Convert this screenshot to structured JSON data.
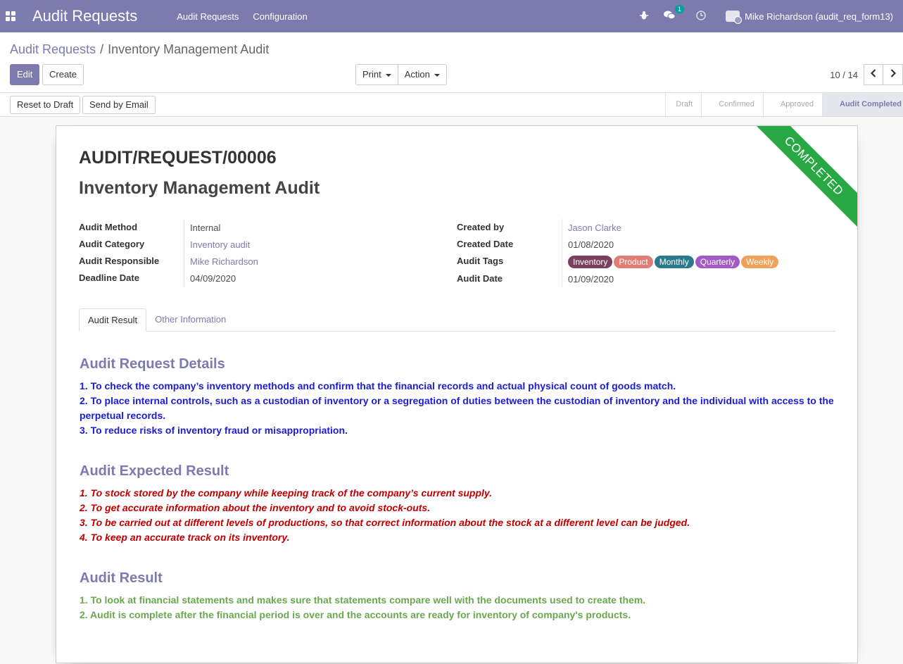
{
  "navbar": {
    "brand": "Audit Requests",
    "menu": [
      "Audit Requests",
      "Configuration"
    ],
    "chat_badge": "1",
    "user": "Mike Richardson (audit_req_form13)"
  },
  "breadcrumb": {
    "parent": "Audit Requests",
    "separator": "/",
    "current": "Inventory Management Audit"
  },
  "toolbar": {
    "edit": "Edit",
    "create": "Create",
    "print": "Print",
    "action": "Action"
  },
  "pager": {
    "value": "10 / 14"
  },
  "statusbar": {
    "reset": "Reset to Draft",
    "email": "Send by Email",
    "stages": [
      "Draft",
      "Confirmed",
      "Approved",
      "Audit Completed"
    ]
  },
  "record": {
    "ribbon": "COMPLETED",
    "reference": "AUDIT/REQUEST/00006",
    "title": "Inventory Management Audit",
    "left_fields": [
      {
        "label": "Audit Method",
        "value": "Internal"
      },
      {
        "label": "Audit Category",
        "value": "Inventory audit"
      },
      {
        "label": "Audit Responsible",
        "value": "Mike Richardson"
      },
      {
        "label": "Deadline Date",
        "value": "04/09/2020"
      }
    ],
    "right_fields": [
      {
        "label": "Created by",
        "value": "Jason Clarke"
      },
      {
        "label": "Created Date",
        "value": "01/08/2020"
      },
      {
        "label": "Audit Tags",
        "value": ""
      },
      {
        "label": "Audit Date",
        "value": "01/09/2020"
      }
    ],
    "tags": [
      {
        "name": "Inventory",
        "color": "#7a3e5e"
      },
      {
        "name": "Product",
        "color": "#e07d75"
      },
      {
        "name": "Monthly",
        "color": "#2b7a8b"
      },
      {
        "name": "Quarterly",
        "color": "#a25ac4"
      },
      {
        "name": "Weekly",
        "color": "#f2a15a"
      }
    ]
  },
  "tabs": [
    "Audit Result",
    "Other Information"
  ],
  "sections": {
    "details": {
      "title": "Audit Request Details",
      "lines": [
        "1. To check the company’s inventory methods and confirm that the financial records and actual physical count of goods match.",
        "2. To place internal controls, such as a custodian of inventory or a segregation of duties between the custodian of inventory and the individual with access to the perpetual records.",
        "3. To reduce risks of inventory fraud or misappropriation."
      ]
    },
    "expected": {
      "title": "Audit Expected Result",
      "lines": [
        "1. To stock stored by the company while keeping track of the company’s current supply.",
        "2. To get accurate information about the inventory and to avoid stock-outs.",
        "3. To be carried out at different levels of productions, so that correct information about the stock at a different level can be judged.",
        "4. To keep an accurate track on its inventory."
      ]
    },
    "result": {
      "title": "Audit Result",
      "lines": [
        "1. To look at financial statements and makes sure that statements compare well with the documents used to create them.",
        "2. Audit is complete after the financial period is over and the accounts are ready for inventory of company's products."
      ]
    }
  }
}
